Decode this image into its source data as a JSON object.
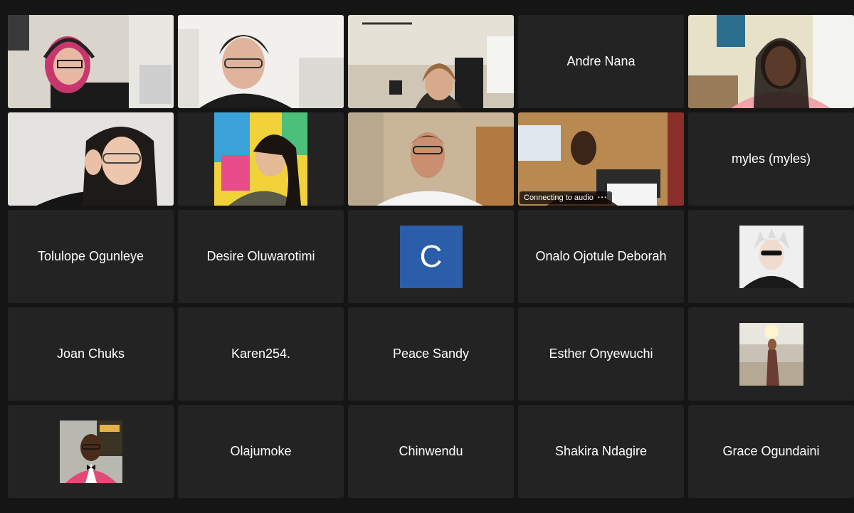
{
  "participants": [
    {
      "name": "Andre Nana"
    },
    {
      "name": "myles (myles)"
    },
    {
      "name": "Tolulope Ogunleye"
    },
    {
      "name": "Desire Oluwarotimi"
    },
    {
      "name": "Onalo Ojotule Deborah"
    },
    {
      "name": "Joan Chuks"
    },
    {
      "name": "Karen254."
    },
    {
      "name": "Peace Sandy"
    },
    {
      "name": "Esther Onyewuchi"
    },
    {
      "name": "Olajumoke"
    },
    {
      "name": "Chinwendu"
    },
    {
      "name": "Shakira Ndagire"
    },
    {
      "name": "Grace Ogundaini"
    }
  ],
  "avatar_letter": "C",
  "connecting_status": "Connecting to audio",
  "more_label": "···",
  "colors": {
    "active_speaker": "#5fc55a",
    "tile_bg": "#232323",
    "avatar_blue": "#2a5ea8"
  }
}
